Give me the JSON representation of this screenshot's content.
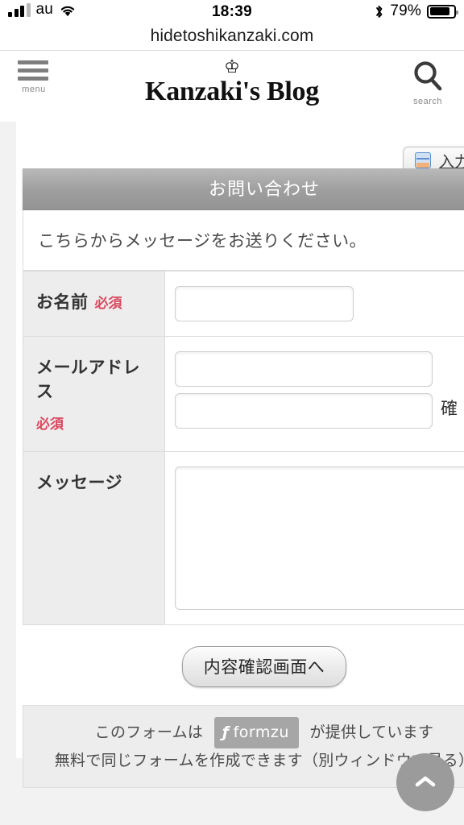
{
  "statusbar": {
    "carrier": "au",
    "time": "18:39",
    "battery_percent": "79%",
    "signal_icon": "signal-bars-icon",
    "wifi_icon": "wifi-icon",
    "bluetooth_icon": "bluetooth-icon",
    "battery_icon": "battery-icon"
  },
  "browser": {
    "url": "hidetoshikanzaki.com"
  },
  "site_header": {
    "menu_label": "menu",
    "menu_icon": "hamburger-menu-icon",
    "logo_crown": "♔",
    "logo_text": "Kanzaki's Blog",
    "search_label": "search",
    "search_icon": "search-icon"
  },
  "form_tab": {
    "label": "入力",
    "icon": "form-input-icon"
  },
  "form": {
    "title": "お問い合わせ",
    "intro": "こちらからメッセージをお送りください。",
    "required_badge": "必須",
    "rows": [
      {
        "label": "お名前",
        "required": "必須",
        "field_type": "text",
        "value": "",
        "placeholder": ""
      },
      {
        "label": "メールアドレス",
        "required": "必須",
        "field_type": "email-pair",
        "value": "",
        "confirm_value": "",
        "confirm_note": "確"
      },
      {
        "label": "メッセージ",
        "required": "",
        "field_type": "textarea",
        "value": "",
        "placeholder": ""
      }
    ],
    "submit_label": "内容確認画面へ",
    "credit_line1_before": "このフォームは",
    "credit_brand": "formzu",
    "credit_brand_mark": "ƒ",
    "credit_line1_after": "が提供しています",
    "credit_line2": "無料で同じフォームを作成できます（別ウィンドウで見る）"
  },
  "fab": {
    "name": "scroll-to-top",
    "icon": "chevron-up-icon"
  },
  "colors": {
    "page_bg": "#f2f2f2",
    "title_bar": "#9e9e9e",
    "required_red": "#d9485f",
    "label_bg": "#ededed",
    "fab_bg": "#9b9b9b",
    "tab_icon_blue": "#5b8fd4"
  }
}
